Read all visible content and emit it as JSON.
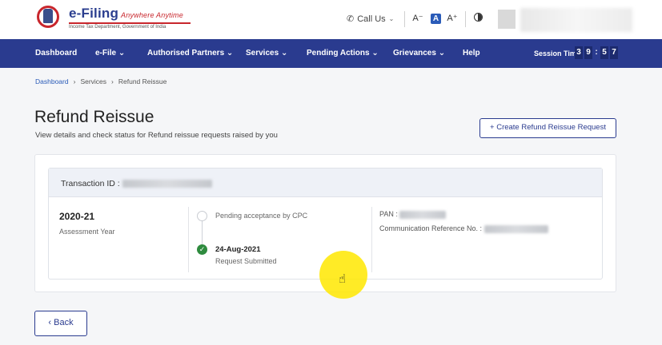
{
  "header": {
    "logo_title": "e-Filing",
    "logo_tagline": "Anywhere Anytime",
    "logo_subtitle": "Income Tax Department, Government of India",
    "call_us": "Call Us",
    "font_decrease": "A⁻",
    "font_normal": "A",
    "font_increase": "A⁺"
  },
  "nav": {
    "items": [
      "Dashboard",
      "e-File",
      "Authorised Partners",
      "Services",
      "Pending Actions",
      "Grievances",
      "Help"
    ],
    "session_label": "Session Time",
    "timer_digits": [
      "3",
      "9",
      "5",
      "7"
    ]
  },
  "breadcrumb": [
    "Dashboard",
    "Services",
    "Refund Reissue"
  ],
  "page": {
    "title": "Refund Reissue",
    "subtitle": "View details and check status for Refund reissue requests raised by you",
    "create_button": "Create Refund Reissue Request"
  },
  "card": {
    "transaction_label": "Transaction ID :",
    "assessment_year": "2020-21",
    "assessment_year_label": "Assessment Year",
    "steps": [
      {
        "label": "Pending acceptance by CPC",
        "date": "",
        "status": "pending"
      },
      {
        "label": "Request Submitted",
        "date": "24-Aug-2021",
        "status": "done"
      }
    ],
    "pan_label": "PAN :",
    "crn_label": "Communication Reference No. :"
  },
  "back_button": "Back",
  "colors": {
    "nav_bg": "#2a3b8f",
    "accent": "#2a5bb8",
    "success": "#2e8b3e",
    "brand_red": "#c8262c"
  }
}
